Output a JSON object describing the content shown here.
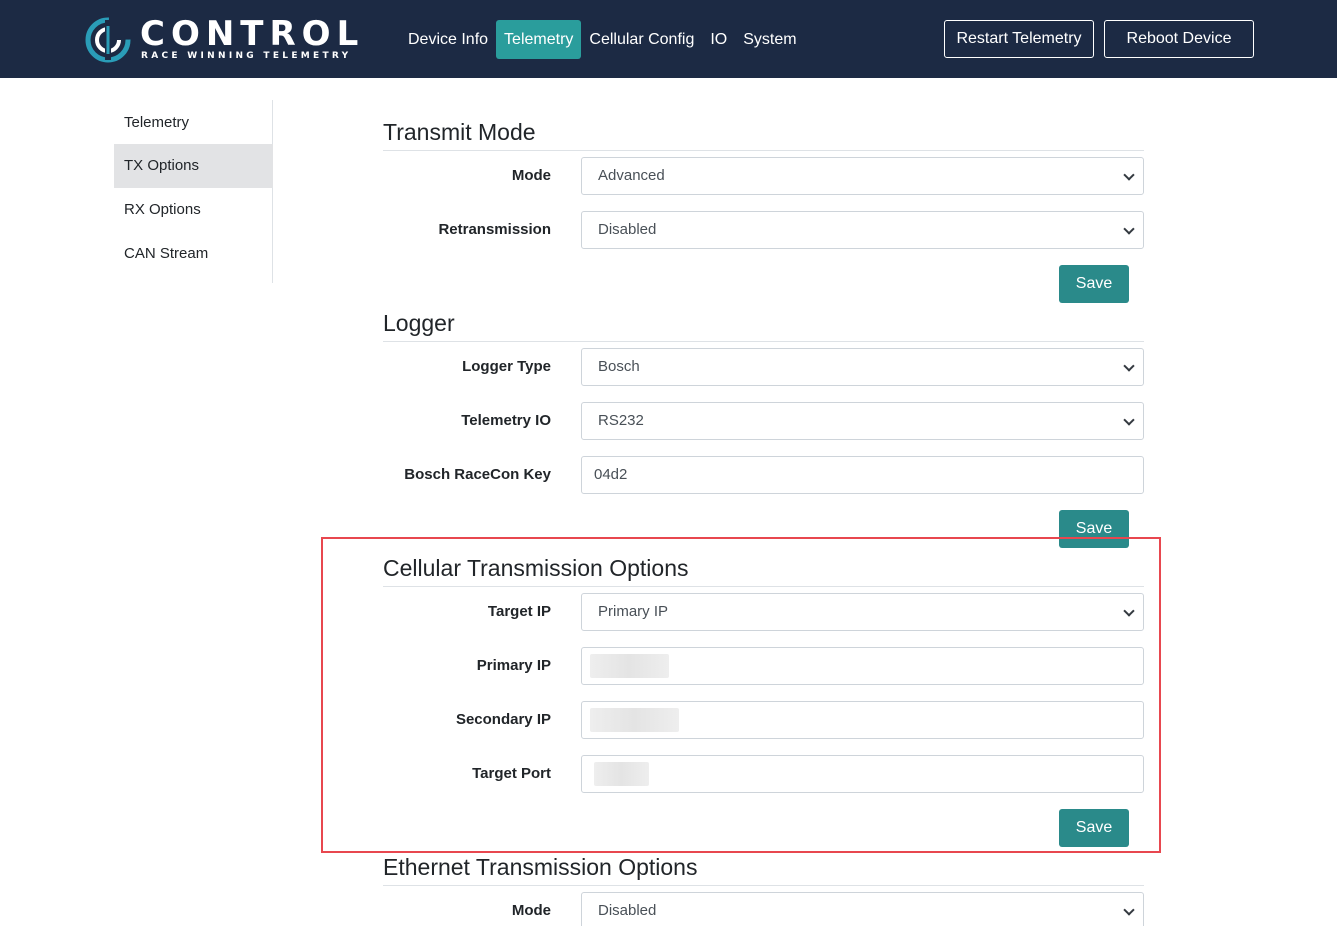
{
  "brand": {
    "name": "CONTROL",
    "tagline": "RACE WINNING TELEMETRY"
  },
  "nav": {
    "items": [
      {
        "label": "Device Info"
      },
      {
        "label": "Telemetry",
        "active": true
      },
      {
        "label": "Cellular Config"
      },
      {
        "label": "IO"
      },
      {
        "label": "System"
      }
    ],
    "restart_label": "Restart Telemetry",
    "reboot_label": "Reboot Device"
  },
  "sidebar": {
    "items": [
      {
        "label": "Telemetry"
      },
      {
        "label": "TX Options",
        "active": true
      },
      {
        "label": "RX Options"
      },
      {
        "label": "CAN Stream"
      }
    ]
  },
  "transmit_mode": {
    "title": "Transmit Mode",
    "mode_label": "Mode",
    "mode_value": "Advanced",
    "retransmission_label": "Retransmission",
    "retransmission_value": "Disabled",
    "save_label": "Save"
  },
  "logger": {
    "title": "Logger",
    "logger_type_label": "Logger Type",
    "logger_type_value": "Bosch",
    "telemetry_io_label": "Telemetry IO",
    "telemetry_io_value": "RS232",
    "racecon_key_label": "Bosch RaceCon Key",
    "racecon_key_value": "04d2",
    "save_label": "Save"
  },
  "cellular": {
    "title": "Cellular Transmission Options",
    "target_ip_label": "Target IP",
    "target_ip_value": "Primary IP",
    "primary_ip_label": "Primary IP",
    "secondary_ip_label": "Secondary IP",
    "target_port_label": "Target Port",
    "save_label": "Save"
  },
  "ethernet": {
    "title": "Ethernet Transmission Options",
    "mode_label": "Mode",
    "mode_value": "Disabled"
  },
  "colors": {
    "navbar_bg": "#1c2a44",
    "accent": "#2a9d9c",
    "save_button": "#2a8a8a",
    "highlight": "#e8474f"
  }
}
